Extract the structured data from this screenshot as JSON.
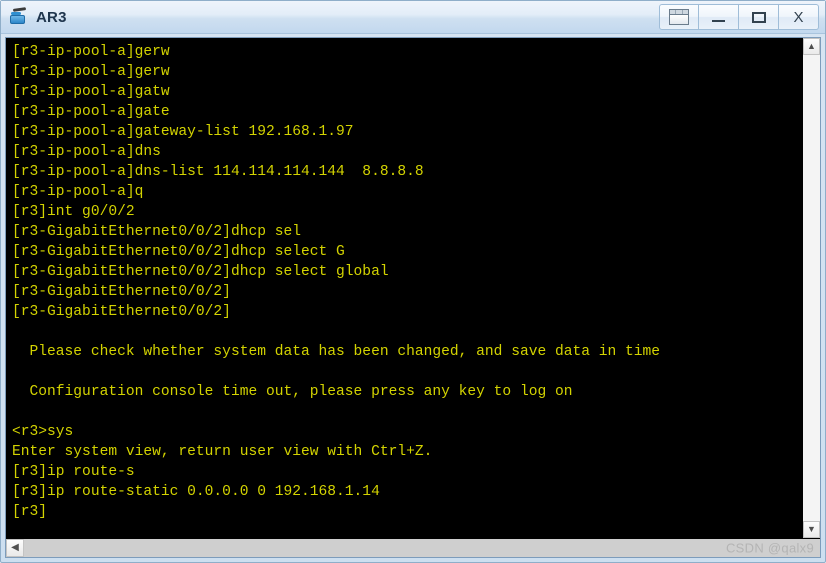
{
  "window": {
    "title": "AR3",
    "icon": "router-icon",
    "buttons": [
      {
        "name": "cascade-button",
        "label": "",
        "glyph": "cascade-icon"
      },
      {
        "name": "minimize-button",
        "label": "–",
        "glyph": "minimize-icon"
      },
      {
        "name": "maximize-button",
        "label": "□",
        "glyph": "maximize-icon"
      },
      {
        "name": "close-button",
        "label": "X",
        "glyph": "close-icon"
      }
    ]
  },
  "terminal": {
    "foreground_color": "#d3d300",
    "background_color": "#000000",
    "lines": [
      "[r3-ip-pool-a]gerw",
      "[r3-ip-pool-a]gerw",
      "[r3-ip-pool-a]gatw",
      "[r3-ip-pool-a]gate",
      "[r3-ip-pool-a]gateway-list 192.168.1.97",
      "[r3-ip-pool-a]dns",
      "[r3-ip-pool-a]dns-list 114.114.114.144  8.8.8.8",
      "[r3-ip-pool-a]q",
      "[r3]int g0/0/2",
      "[r3-GigabitEthernet0/0/2]dhcp sel",
      "[r3-GigabitEthernet0/0/2]dhcp select G",
      "[r3-GigabitEthernet0/0/2]dhcp select global",
      "[r3-GigabitEthernet0/0/2]",
      "[r3-GigabitEthernet0/0/2]",
      "",
      "  Please check whether system data has been changed, and save data in time",
      "",
      "  Configuration console time out, please press any key to log on",
      "",
      "<r3>sys",
      "Enter system view, return user view with Ctrl+Z.",
      "[r3]ip route-s",
      "[r3]ip route-static 0.0.0.0 0 192.168.1.14",
      "[r3]"
    ]
  },
  "scrollbars": {
    "vertical": {
      "up_arrow": "▲",
      "down_arrow": "▼"
    },
    "horizontal": {
      "left_arrow": "◀"
    }
  },
  "watermark": "CSDN @qalx9"
}
